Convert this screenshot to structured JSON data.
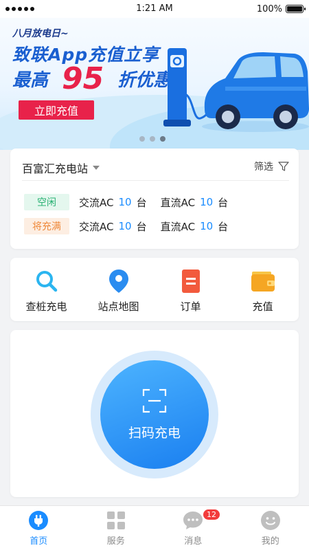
{
  "status_bar": {
    "time": "1:21 AM",
    "battery": "100%",
    "battery_level": 1.0
  },
  "banner": {
    "small_text": "八月放电日~",
    "line1": "致联App充值立享",
    "line2_prefix": "最高",
    "line2_number": "95",
    "line2_suffix": "折优惠",
    "button": "立即充值",
    "page_count": 3,
    "active_page": 3
  },
  "station": {
    "name": "百富汇充电站",
    "filter_label": "筛选",
    "rows": [
      {
        "status": "空闲",
        "ac_label": "交流AC",
        "ac_count": "10",
        "ac_unit": "台",
        "dc_label": "直流AC",
        "dc_count": "10",
        "dc_unit": "台"
      },
      {
        "status": "将充满",
        "ac_label": "交流AC",
        "ac_count": "10",
        "ac_unit": "台",
        "dc_label": "直流AC",
        "dc_count": "10",
        "dc_unit": "台"
      }
    ]
  },
  "menu": {
    "items": [
      {
        "label": "查桩充电",
        "icon": "search-icon"
      },
      {
        "label": "站点地图",
        "icon": "location-pin-icon"
      },
      {
        "label": "订单",
        "icon": "order-icon"
      },
      {
        "label": "充值",
        "icon": "wallet-icon"
      }
    ]
  },
  "scan": {
    "label": "扫码充电"
  },
  "tabbar": {
    "items": [
      {
        "label": "首页",
        "icon": "plug-icon",
        "active": true
      },
      {
        "label": "服务",
        "icon": "grid-icon",
        "active": false
      },
      {
        "label": "消息",
        "icon": "message-icon",
        "active": false
      },
      {
        "label": "我的",
        "icon": "smile-icon",
        "active": false
      }
    ],
    "message_badge": "12"
  },
  "colors": {
    "accent": "#1a8cff",
    "banner_red": "#e8224a",
    "idle_green": "#27b072",
    "full_orange": "#ef8a3c"
  }
}
